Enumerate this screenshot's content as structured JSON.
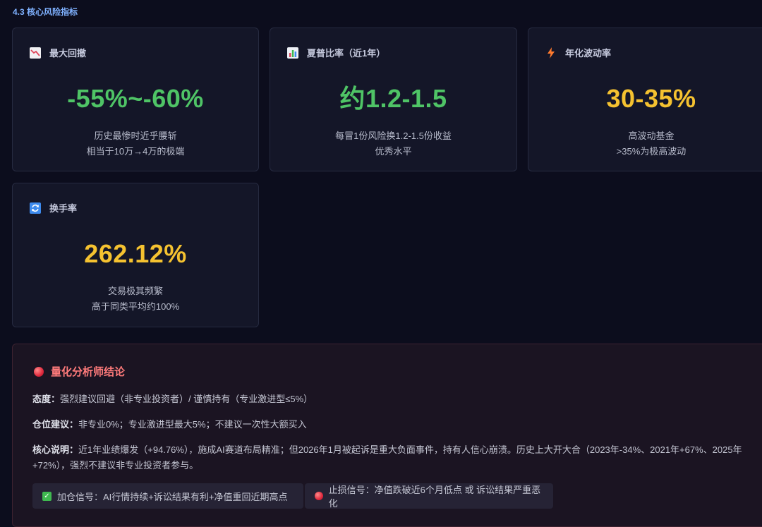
{
  "section": {
    "title": "4.3 核心风险指标"
  },
  "cards": [
    {
      "icon": "chart-decreasing-icon",
      "label": "最大回撤",
      "value": "-55%~-60%",
      "value_color": "#4fc466",
      "sub1": "历史最惨时近乎腰斩",
      "sub2": "相当于10万→4万的极端"
    },
    {
      "icon": "bar-chart-icon",
      "label": "夏普比率（近1年）",
      "value": "约1.2-1.5",
      "value_color": "#4fc466",
      "sub1": "每冒1份风险换1.2-1.5份收益",
      "sub2": "优秀水平"
    },
    {
      "icon": "lightning-icon",
      "label": "年化波动率",
      "value": "30-35%",
      "value_color": "#f5c230",
      "sub1": "高波动基金",
      "sub2": ">35%为极高波动"
    },
    {
      "icon": "refresh-icon",
      "label": "换手率",
      "value": "262.12%",
      "value_color": "#f5c230",
      "sub1": "交易极其频繁",
      "sub2": "高于同类平均约100%"
    }
  ],
  "conclusion": {
    "title": "量化分析师结论",
    "attitude_label": "态度：",
    "attitude_text": "强烈建议回避（非专业投资者）/ 谨慎持有（专业激进型≤5%）",
    "position_label": "仓位建议：",
    "position_text": "非专业0%；专业激进型最大5%；不建议一次性大额买入",
    "core_label": "核心说明：",
    "core_text": "近1年业绩爆发（+94.76%），施成AI赛道布局精准；但2026年1月被起诉是重大负面事件，持有人信心崩溃。历史上大开大合（2023年-34%、2021年+67%、2025年+72%），强烈不建议非专业投资者参与。",
    "add_signal": "加仓信号：AI行情持续+诉讼结果有利+净值重回近期高点",
    "stop_signal": "止损信号：净值跌破近6个月低点 或 诉讼结果严重恶化"
  }
}
